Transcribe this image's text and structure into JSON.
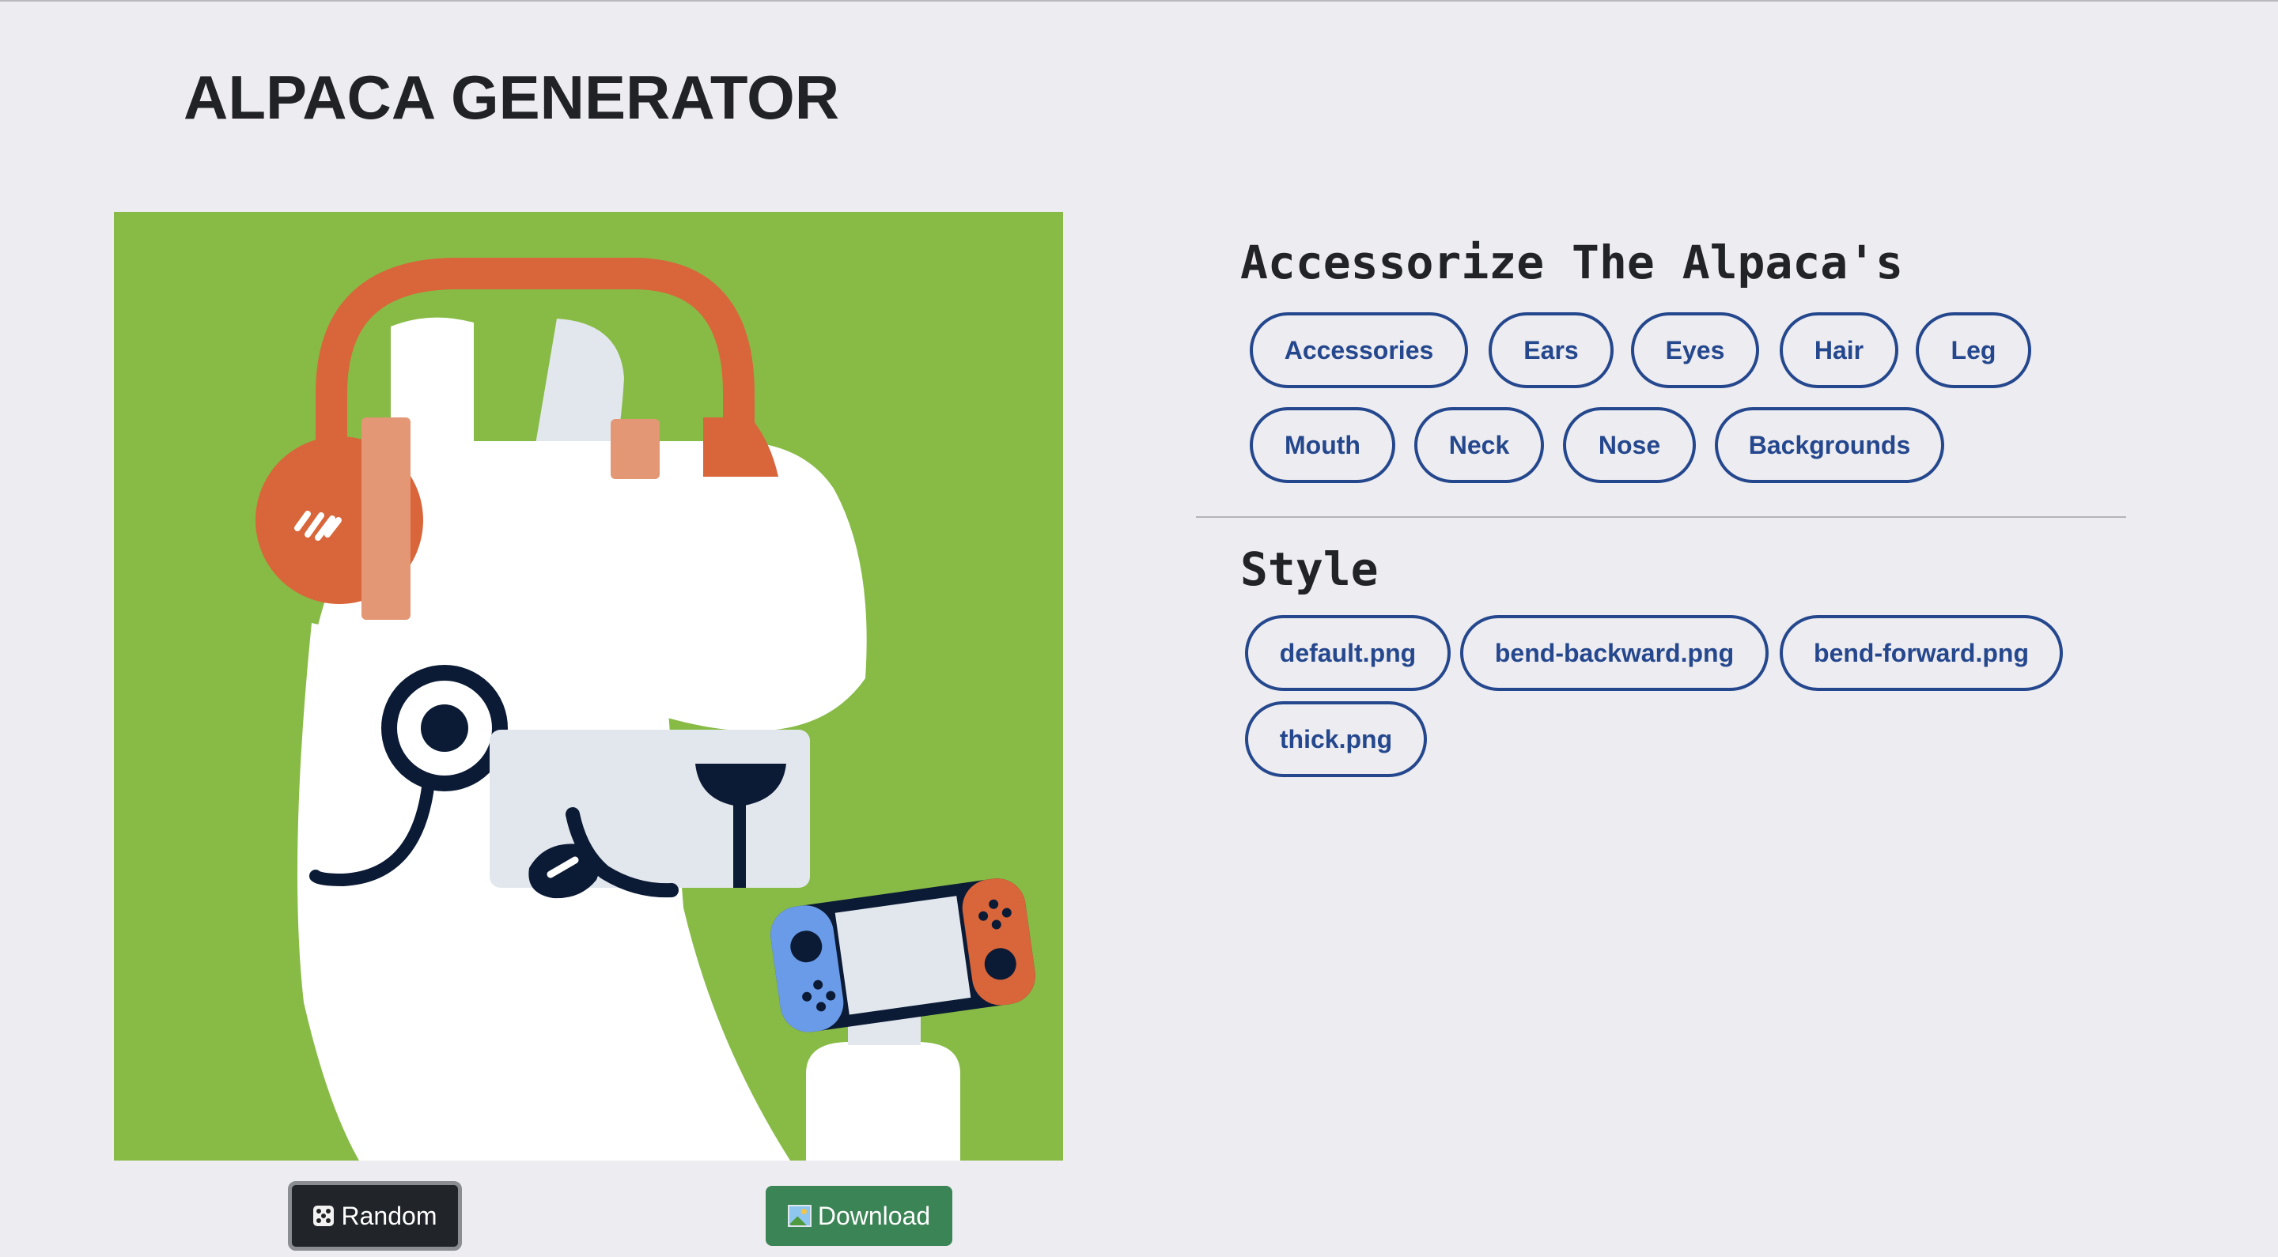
{
  "app": {
    "title": "ALPACA GENERATOR"
  },
  "colors": {
    "background": "#88bb46",
    "option_border": "#24478d",
    "download_button": "#3b8455",
    "random_button": "#212529"
  },
  "preview": {
    "background": "green",
    "accessories": "headphone",
    "ears": "default",
    "eyes": "default",
    "leg": "game-console",
    "mouth": "tongue",
    "nose": "default"
  },
  "actions": {
    "random_label": "Random",
    "random_icon": "die-icon",
    "download_label": "Download",
    "download_icon": "picture-icon"
  },
  "accessorize": {
    "heading": "Accessorize The Alpaca's",
    "options": [
      "Accessories",
      "Ears",
      "Eyes",
      "Hair",
      "Leg",
      "Mouth",
      "Neck",
      "Nose",
      "Backgrounds"
    ]
  },
  "style": {
    "heading": "Style",
    "options": [
      "default.png",
      "bend-backward.png",
      "bend-forward.png",
      "thick.png"
    ]
  }
}
